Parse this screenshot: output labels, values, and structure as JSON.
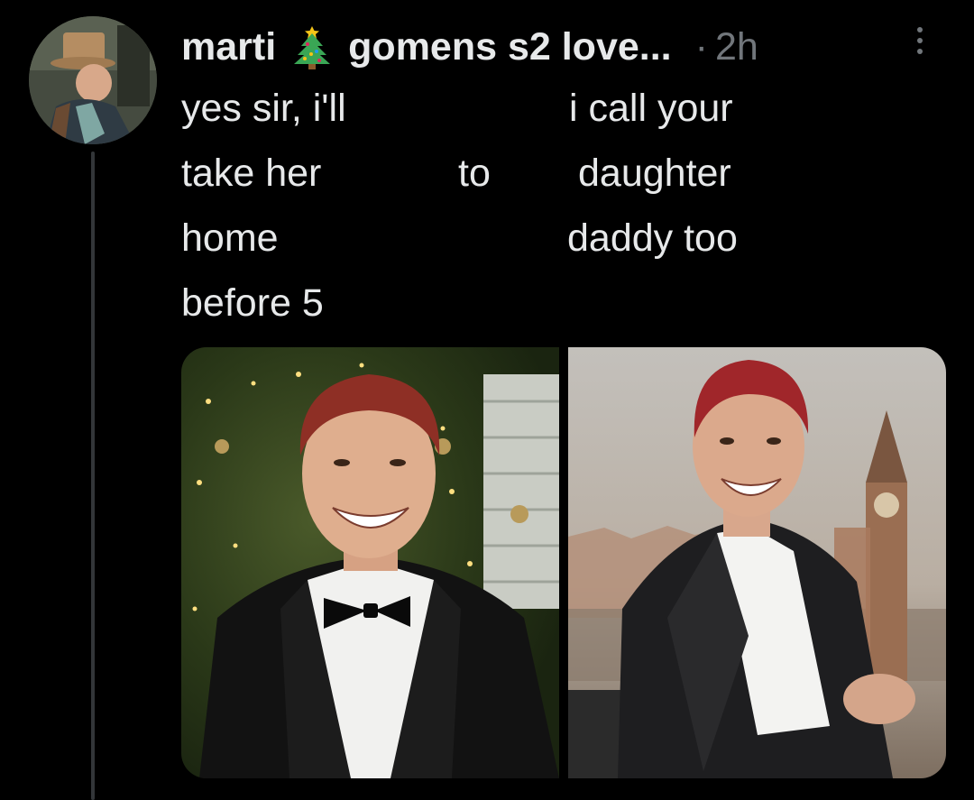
{
  "tweet": {
    "display_name": "marti",
    "name_emoji": "christmas-tree",
    "name_suffix": "gomens s2 love...",
    "separator": "·",
    "timestamp": "2h",
    "text_lines": {
      "col1": [
        "yes sir, i'll",
        "take her",
        "home",
        "before 5"
      ],
      "col2": "to",
      "col3": [
        "i call your",
        "daughter",
        "daddy too"
      ]
    },
    "media": [
      {
        "subject": "man with red hair in black tuxedo and bow tie in front of christmas tree"
      },
      {
        "subject": "man with red hair in black blazer and white shirt with city skyline and clock tower background"
      }
    ]
  },
  "colors": {
    "background": "#000000",
    "primary_text": "#e7e9ea",
    "secondary_text": "#71767b",
    "thread_line": "#333639"
  }
}
